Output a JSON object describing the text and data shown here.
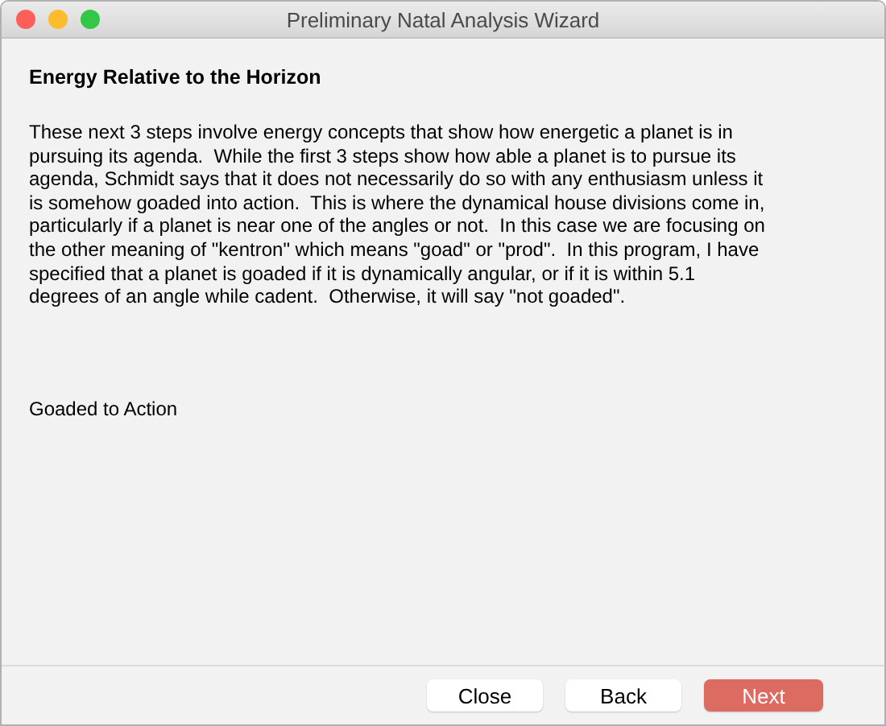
{
  "window": {
    "title": "Preliminary Natal Analysis Wizard"
  },
  "heading": "Energy Relative to the Horizon",
  "paragraph": "These next 3 steps involve energy concepts that show how energetic a planet is in\npursuing its agenda.  While the first 3 steps show how able a planet is to pursue its\nagenda, Schmidt says that it does not necessarily do so with any enthusiasm unless it\nis somehow goaded into action.  This is where the dynamical house divisions come in,\nparticularly if a planet is near one of the angles or not.  In this case we are focusing on\nthe other meaning of \"kentron\" which means \"goad\" or \"prod\".  In this program, I have\nspecified that a planet is goaded if it is dynamically angular, or if it is within 5.1\ndegrees of an angle while cadent.  Otherwise, it will say \"not goaded\".",
  "result_label": "Goaded to Action",
  "buttons": [
    {
      "label": "Close",
      "default": false
    },
    {
      "label": "Back",
      "default": false
    },
    {
      "label": "Next",
      "default": true
    }
  ]
}
